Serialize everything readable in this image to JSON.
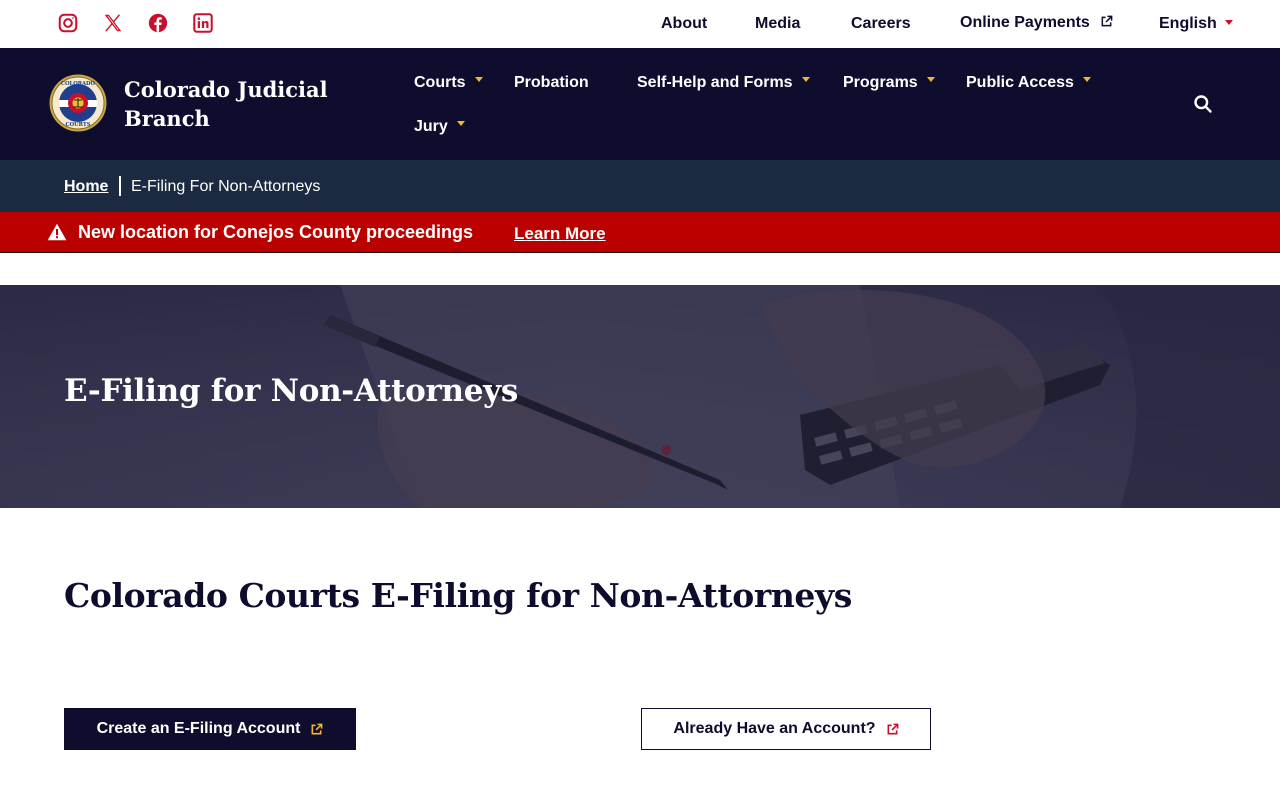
{
  "social": {
    "icons": [
      "instagram-icon",
      "x-twitter-icon",
      "facebook-icon",
      "linkedin-icon"
    ],
    "color": "#c8102e"
  },
  "utility_nav": {
    "about": "About",
    "media": "Media",
    "careers": "Careers",
    "online_payments": "Online Payments",
    "language": "English"
  },
  "brand": {
    "name": "Colorado Judicial Branch",
    "logo_text_top": "COLORADO",
    "logo_text_bottom": "COURTS"
  },
  "main_nav": {
    "courts": "Courts",
    "probation": "Probation",
    "self_help": "Self-Help and Forms",
    "programs": "Programs",
    "public_access": "Public Access",
    "jury": "Jury"
  },
  "breadcrumb": {
    "home": "Home",
    "current": "E-Filing For Non-Attorneys"
  },
  "alert": {
    "message": "New location for Conejos County proceedings",
    "link": "Learn More"
  },
  "hero": {
    "title": "E-Filing for Non-Attorneys"
  },
  "content": {
    "heading": "Colorado Courts E-Filing for Non-Attorneys",
    "create_account": "Create an E-Filing Account",
    "already_have": "Already Have an Account?"
  },
  "colors": {
    "navy": "#0f0d2e",
    "breadcrumb_bg": "#1b2a40",
    "alert_red": "#bb0000",
    "accent_gold": "#f2b632",
    "accent_red": "#c8102e"
  }
}
